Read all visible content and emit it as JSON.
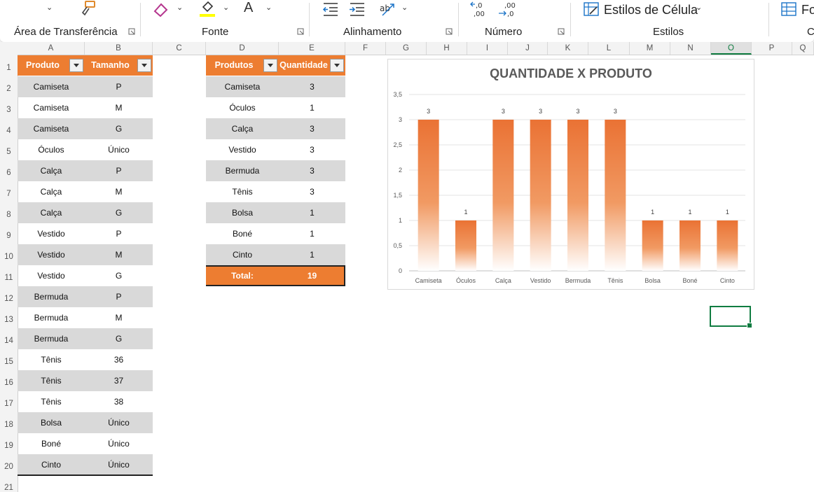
{
  "ribbon": {
    "groups": [
      "Área de Transferência",
      "Fonte",
      "Alinhamento",
      "Número",
      "Estilos"
    ],
    "styles_button": "Estilos de Célula",
    "cut_off_right": "Fo",
    "cut_off_label": "C",
    "font_letter": "A"
  },
  "columns": [
    "A",
    "B",
    "C",
    "D",
    "E",
    "F",
    "G",
    "H",
    "I",
    "J",
    "K",
    "L",
    "M",
    "N",
    "O",
    "P",
    "Q"
  ],
  "selected_column": "O",
  "rows": [
    "1",
    "2",
    "3",
    "4",
    "5",
    "6",
    "7",
    "8",
    "9",
    "10",
    "11",
    "12",
    "13",
    "14",
    "15",
    "16",
    "17",
    "18",
    "19",
    "20",
    "21"
  ],
  "table1": {
    "headers": [
      "Produto",
      "Tamanho"
    ],
    "rows": [
      [
        "Camiseta",
        "P"
      ],
      [
        "Camiseta",
        "M"
      ],
      [
        "Camiseta",
        "G"
      ],
      [
        "Óculos",
        "Único"
      ],
      [
        "Calça",
        "P"
      ],
      [
        "Calça",
        "M"
      ],
      [
        "Calça",
        "G"
      ],
      [
        "Vestido",
        "P"
      ],
      [
        "Vestido",
        "M"
      ],
      [
        "Vestido",
        "G"
      ],
      [
        "Bermuda",
        "P"
      ],
      [
        "Bermuda",
        "M"
      ],
      [
        "Bermuda",
        "G"
      ],
      [
        "Tênis",
        "36"
      ],
      [
        "Tênis",
        "37"
      ],
      [
        "Tênis",
        "38"
      ],
      [
        "Bolsa",
        "Único"
      ],
      [
        "Boné",
        "Único"
      ],
      [
        "Cinto",
        "Único"
      ]
    ]
  },
  "table2": {
    "headers": [
      "Produtos",
      "Quantidade"
    ],
    "rows": [
      [
        "Camiseta",
        "3"
      ],
      [
        "Óculos",
        "1"
      ],
      [
        "Calça",
        "3"
      ],
      [
        "Vestido",
        "3"
      ],
      [
        "Bermuda",
        "3"
      ],
      [
        "Tênis",
        "3"
      ],
      [
        "Bolsa",
        "1"
      ],
      [
        "Boné",
        "1"
      ],
      [
        "Cinto",
        "1"
      ]
    ],
    "total_label": "Total:",
    "total_value": "19"
  },
  "colors": {
    "accent": "#ed7d31",
    "band": "#d9d9d9",
    "excel_green": "#107c41"
  },
  "chart_data": {
    "type": "bar",
    "title": "QUANTIDADE X PRODUTO",
    "categories": [
      "Camiseta",
      "Óculos",
      "Calça",
      "Vestido",
      "Bermuda",
      "Tênis",
      "Bolsa",
      "Boné",
      "Cinto"
    ],
    "values": [
      3,
      1,
      3,
      3,
      3,
      3,
      1,
      1,
      1
    ],
    "ylim": [
      0,
      3.5
    ],
    "yticks": [
      "0",
      "0,5",
      "1",
      "1,5",
      "2",
      "2,5",
      "3",
      "3,5"
    ],
    "grid": true,
    "data_labels": true,
    "legend": "none",
    "xlabel": "",
    "ylabel": ""
  }
}
